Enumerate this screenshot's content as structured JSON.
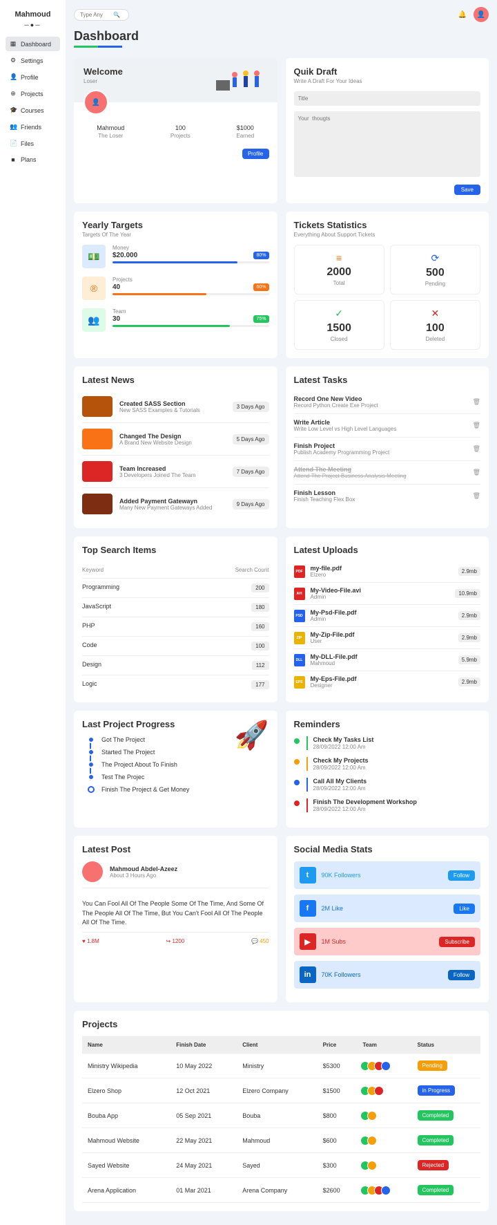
{
  "sidebar": {
    "title": "Mahmoud",
    "items": [
      {
        "icon": "▦",
        "label": "Dashboard",
        "active": true
      },
      {
        "icon": "⚙",
        "label": "Settings"
      },
      {
        "icon": "👤",
        "label": "Profile"
      },
      {
        "icon": "⊕",
        "label": "Projects"
      },
      {
        "icon": "🎓",
        "label": "Courses"
      },
      {
        "icon": "👥",
        "label": "Friends"
      },
      {
        "icon": "📄",
        "label": "Files"
      },
      {
        "icon": "■",
        "label": "Plans"
      }
    ]
  },
  "search_placeholder": "Type Any",
  "page_title": "Dashboard",
  "welcome": {
    "title": "Welcome",
    "sub": "Loser",
    "stats": [
      {
        "val": "Mahmoud",
        "lbl": "The Loser"
      },
      {
        "val": "100",
        "lbl": "Projects"
      },
      {
        "val": "$1000",
        "lbl": "Earned"
      }
    ],
    "profile_btn": "Profile"
  },
  "draft": {
    "title": "Quik Draft",
    "sub": "Write A Draft For Your Ideas",
    "title_ph": "Title",
    "thoughts_ph": "Your  thougts",
    "save": "Save"
  },
  "targets": {
    "title": "Yearly Targets",
    "sub": "Targets Of The Year",
    "items": [
      {
        "icon": "💵",
        "color": "#2563eb",
        "bg": "#dbeafe",
        "lbl": "Money",
        "val": "$20.000",
        "pct": "80%",
        "width": "80%"
      },
      {
        "icon": "®",
        "color": "#f97316",
        "bg": "#ffedd5",
        "lbl": "Projects",
        "val": "40",
        "pct": "60%",
        "width": "60%"
      },
      {
        "icon": "👥",
        "color": "#22c55e",
        "bg": "#dcfce7",
        "lbl": "Team",
        "val": "30",
        "pct": "75%",
        "width": "75%"
      }
    ]
  },
  "tickets": {
    "title": "Tickets Statistics",
    "sub": "Everything About Support Tickets",
    "items": [
      {
        "icon": "≡",
        "color": "#f97316",
        "num": "2000",
        "lbl": "Total"
      },
      {
        "icon": "⟳",
        "color": "#2563eb",
        "num": "500",
        "lbl": "Pending"
      },
      {
        "icon": "✓",
        "color": "#22c55e",
        "num": "1500",
        "lbl": "Closed"
      },
      {
        "icon": "✕",
        "color": "#dc2626",
        "num": "100",
        "lbl": "Deleted"
      }
    ]
  },
  "news": {
    "title": "Latest News",
    "items": [
      {
        "color": "#b45309",
        "title": "Created SASS Section",
        "sub": "New SASS Examples & Tutorials",
        "badge": "3 Days Ago"
      },
      {
        "color": "#f97316",
        "title": "Changed The Design",
        "sub": "A Brand New Website Design",
        "badge": "5 Days Ago"
      },
      {
        "color": "#dc2626",
        "title": "Team Increased",
        "sub": "3 Developers Joined The Team",
        "badge": "7 Days Ago"
      },
      {
        "color": "#7c2d12",
        "title": "Added Payment Gatewayn",
        "sub": "Many New Payment Gateways Added",
        "badge": "9 Days Ago"
      }
    ]
  },
  "tasks": {
    "title": "Latest Tasks",
    "items": [
      {
        "title": "Record One New Video",
        "sub": "Record Python Create Exe Project",
        "done": false
      },
      {
        "title": "Write Article",
        "sub": "Write Low Level vs High Level Languages",
        "done": false
      },
      {
        "title": "Finish Project",
        "sub": "Publish Academy Programming Project",
        "done": false
      },
      {
        "title": "Attend The Meeting",
        "sub": "Attend The Project Business Analysis Meeting",
        "done": true
      },
      {
        "title": "Finish Lesson",
        "sub": "Finish Teaching Flex Box",
        "done": false
      }
    ]
  },
  "top_search": {
    "title": "Top Search Items",
    "keyword": "Keyword",
    "count": "Search Count",
    "items": [
      {
        "kw": "Programming",
        "cnt": "200"
      },
      {
        "kw": "JavaScript",
        "cnt": "180"
      },
      {
        "kw": "PHP",
        "cnt": "160"
      },
      {
        "kw": "Code",
        "cnt": "100"
      },
      {
        "kw": "Design",
        "cnt": "112"
      },
      {
        "kw": "Logic",
        "cnt": "177"
      }
    ]
  },
  "uploads": {
    "title": "Latest Uploads",
    "items": [
      {
        "ext": "PDF",
        "color": "#dc2626",
        "name": "my-file.pdf",
        "user": "Elzero",
        "size": "2.9mb"
      },
      {
        "ext": "AVI",
        "color": "#dc2626",
        "name": "My-Video-File.avi",
        "user": "Admin",
        "size": "10.9mb"
      },
      {
        "ext": "PSD",
        "color": "#2563eb",
        "name": "My-Psd-File.pdf",
        "user": "Admin",
        "size": "2.9mb"
      },
      {
        "ext": "ZIP",
        "color": "#eab308",
        "name": "My-Zip-File.pdf",
        "user": "User",
        "size": "2.9mb"
      },
      {
        "ext": "DLL",
        "color": "#2563eb",
        "name": "My-DLL-File.pdf",
        "user": "Mahmoud",
        "size": "5.9mb"
      },
      {
        "ext": "EPS",
        "color": "#eab308",
        "name": "My-Eps-File.pdf",
        "user": "Designer",
        "size": "2.9mb"
      }
    ]
  },
  "progress": {
    "title": "Last Project Progress",
    "items": [
      {
        "txt": "Got The Project",
        "done": true
      },
      {
        "txt": "Started The Project",
        "done": true
      },
      {
        "txt": "The Project About To Finish",
        "done": true
      },
      {
        "txt": "Test The Projec",
        "done": true
      },
      {
        "txt": "Finish The Project & Get Money",
        "done": false
      }
    ]
  },
  "reminders": {
    "title": "Reminders",
    "items": [
      {
        "color": "#22c55e",
        "title": "Check My Tasks List",
        "date": "28/09/2022   12:00 Am"
      },
      {
        "color": "#f59e0b",
        "title": "Check My Projects",
        "date": "28/09/2022   12:00 Am"
      },
      {
        "color": "#2563eb",
        "title": "Call All My Clients",
        "date": "28/09/2022   12:00 Am"
      },
      {
        "color": "#dc2626",
        "title": "Finish The Development Workshop",
        "date": "28/09/2022   12:00 Am"
      }
    ]
  },
  "post": {
    "title": "Latest Post",
    "user": "Mahmoud Abdel-Azeez",
    "time": "About 3 Hours Ago",
    "content": "You Can Fool All Of The People Some Of The Time, And Some Of The People All Of The Time, But You Can't Fool All Of The People All Of The Time.",
    "likes": "1.8M",
    "shares": "1200",
    "comments": "450"
  },
  "social": {
    "title": "Social Media Stats",
    "items": [
      {
        "bg": "#dbeafe",
        "iconbg": "#1d9bf0",
        "icon": "t",
        "txt": "90K Followers",
        "txtcolor": "#1d9bf0",
        "btn": "Follow",
        "btnbg": "#1d9bf0"
      },
      {
        "bg": "#dbeafe",
        "iconbg": "#1877f2",
        "icon": "f",
        "txt": "2M Like",
        "txtcolor": "#1877f2",
        "btn": "Like",
        "btnbg": "#1877f2"
      },
      {
        "bg": "#fecaca",
        "iconbg": "#dc2626",
        "icon": "▶",
        "txt": "1M Subs",
        "txtcolor": "#dc2626",
        "btn": "Subscribe",
        "btnbg": "#dc2626"
      },
      {
        "bg": "#dbeafe",
        "iconbg": "#0a66c2",
        "icon": "in",
        "txt": "70K Followers",
        "txtcolor": "#0a66c2",
        "btn": "Follow",
        "btnbg": "#0a66c2"
      }
    ]
  },
  "projects": {
    "title": "Projects",
    "headers": [
      "Name",
      "Finish Date",
      "Client",
      "Price",
      "Team",
      "Status"
    ],
    "rows": [
      {
        "name": "Ministry Wikipedia",
        "date": "10 May 2022",
        "client": "Ministry",
        "price": "$5300",
        "team": 4,
        "status": "Pending",
        "color": "#f59e0b"
      },
      {
        "name": "Elzero Shop",
        "date": "12 Oct 2021",
        "client": "Elzero Company",
        "price": "$1500",
        "team": 3,
        "status": "in Progress",
        "color": "#2563eb"
      },
      {
        "name": "Bouba App",
        "date": "05 Sep 2021",
        "client": "Bouba",
        "price": "$800",
        "team": 2,
        "status": "Completed",
        "color": "#22c55e"
      },
      {
        "name": "Mahmoud Website",
        "date": "22 May 2021",
        "client": "Mahmoud",
        "price": "$600",
        "team": 2,
        "status": "Completed",
        "color": "#22c55e"
      },
      {
        "name": "Sayed Website",
        "date": "24 May 2021",
        "client": "Sayed",
        "price": "$300",
        "team": 2,
        "status": "Rejected",
        "color": "#dc2626"
      },
      {
        "name": "Arena Application",
        "date": "01 Mar 2021",
        "client": "Arena Company",
        "price": "$2600",
        "team": 4,
        "status": "Completed",
        "color": "#22c55e"
      }
    ]
  }
}
